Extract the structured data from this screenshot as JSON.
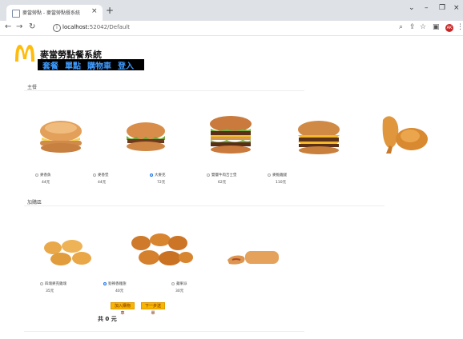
{
  "browser": {
    "tab_title": "麥當勞點 - 麥當勞點餐系統",
    "tab_close": "×",
    "new_tab": "+",
    "url_host": "localhost",
    "url_rest": ":52042/Default",
    "controls": {
      "minimize": "–",
      "restore": "❐",
      "close": "×"
    },
    "avatar_text": "AK"
  },
  "site": {
    "title": "麥當勞點餐系統",
    "brand_color": "#ffbc0d",
    "nav": [
      "套餐",
      "單點",
      "購物車",
      "登入"
    ]
  },
  "main": {
    "label": "主餐",
    "items": [
      {
        "name": "麥香魚",
        "price": "44元",
        "selected": false
      },
      {
        "name": "麥香堡",
        "price": "44元",
        "selected": false
      },
      {
        "name": "大麥克",
        "price": "72元",
        "selected": true
      },
      {
        "name": "雙層牛肉吉士堡",
        "price": "62元",
        "selected": false
      },
      {
        "name": "麥脆雞腿",
        "price": "110元",
        "selected": false
      }
    ]
  },
  "sides": {
    "label": "加購區",
    "items": [
      {
        "name": "四塊麥克雞塊",
        "price": "35元",
        "selected": false
      },
      {
        "name": "勁辣香雞翅",
        "price": "40元",
        "selected": true
      },
      {
        "name": "蘋果派",
        "price": "30元",
        "selected": false
      }
    ]
  },
  "actions": {
    "add_to_cart": "加入購物車",
    "next": "下一步送單"
  },
  "total_text": "共 0 元"
}
